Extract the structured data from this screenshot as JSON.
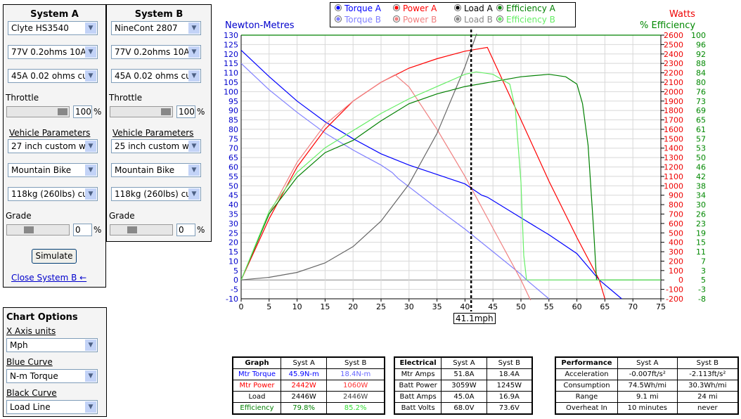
{
  "systemA": {
    "title": "System A",
    "motor": "Clyte HS3540",
    "battery": "77V 0.2ohms 10A",
    "controller": "45A 0.02 ohms cu",
    "throttle_label": "Throttle",
    "throttle": "100",
    "pct": "%",
    "vehicle_label": "Vehicle Parameters",
    "wheel": "27 inch custom w",
    "frame": "Mountain Bike",
    "weight": "118kg (260lbs) cu",
    "grade_label": "Grade",
    "grade": "0",
    "simulate": "Simulate",
    "close_b": "Close System B ←"
  },
  "systemB": {
    "title": "System B",
    "motor": "NineCont 2807",
    "battery": "77V 0.2ohms 10A",
    "controller": "45A 0.02 ohms cu",
    "throttle_label": "Throttle",
    "throttle": "100",
    "pct": "%",
    "vehicle_label": "Vehicle Parameters",
    "wheel": "25 inch custom w",
    "frame": "Mountain Bike",
    "weight": "118kg (260lbs) cu",
    "grade_label": "Grade",
    "grade": "0"
  },
  "chart_options": {
    "title": "Chart Options",
    "x_axis_label": "X Axis units",
    "x_axis": "Mph",
    "blue_label": "Blue Curve",
    "blue": "N-m Torque",
    "black_label": "Black Curve",
    "black": "Load Line"
  },
  "legend": [
    {
      "label": "Torque A",
      "color": "#0000ff"
    },
    {
      "label": "Power A",
      "color": "#ff0000"
    },
    {
      "label": "Load A",
      "color": "#000000"
    },
    {
      "label": "Efficiency A",
      "color": "#008000"
    },
    {
      "label": "Torque B",
      "color": "#8080ff"
    },
    {
      "label": "Power B",
      "color": "#f08080"
    },
    {
      "label": "Load B",
      "color": "#888888"
    },
    {
      "label": "Efficiency B",
      "color": "#66ee66"
    }
  ],
  "chart_data": {
    "type": "line",
    "ylabel_left": "Newton-Metres",
    "ylabel_right1": "Watts",
    "ylabel_right2": "% Efficiency",
    "x_ticks": [
      0,
      5,
      10,
      15,
      20,
      25,
      30,
      35,
      40,
      45,
      50,
      55,
      60,
      65,
      70,
      75
    ],
    "xlim": [
      0,
      75
    ],
    "ylim_left": [
      -10,
      130
    ],
    "ylim_watts": [
      -200,
      2600
    ],
    "left_ticks": [
      130,
      125,
      120,
      115,
      110,
      105,
      100,
      95,
      90,
      85,
      80,
      75,
      70,
      65,
      60,
      55,
      50,
      45,
      40,
      35,
      30,
      25,
      20,
      15,
      10,
      5,
      0,
      -5,
      -10
    ],
    "watts_ticks": [
      2600,
      2500,
      2400,
      2300,
      2200,
      2100,
      2000,
      1900,
      1800,
      1700,
      1600,
      1500,
      1400,
      1300,
      1200,
      1100,
      1000,
      900,
      800,
      700,
      600,
      500,
      400,
      300,
      200,
      100,
      0,
      -100,
      -200
    ],
    "eff_ticks": [
      "100",
      "96",
      "92",
      "88",
      "84",
      "80",
      "76",
      "73",
      "69",
      "65",
      "61",
      "57",
      "53",
      "50",
      "46",
      "42",
      "38",
      "34",
      "30",
      "26",
      "23",
      "19",
      "15",
      "11",
      "7",
      "3",
      "5",
      "-3",
      "-8"
    ],
    "grid": true,
    "cursor_x": 41.1,
    "cursor_label": "41.1mph",
    "series": [
      {
        "name": "Torque A",
        "axis": "nm",
        "color": "#0000ff",
        "x": [
          0,
          5,
          10,
          15,
          20,
          25,
          30,
          35,
          40,
          43,
          44,
          50,
          55,
          60,
          64,
          68
        ],
        "y": [
          122,
          108,
          95,
          84,
          75,
          67,
          61,
          56,
          51,
          45,
          44,
          33,
          24,
          14,
          0,
          -10
        ]
      },
      {
        "name": "Torque B",
        "axis": "nm",
        "color": "#8080ff",
        "x": [
          0,
          5,
          10,
          15,
          20,
          25,
          27,
          28,
          35,
          40,
          45,
          50,
          51,
          55
        ],
        "y": [
          115,
          101,
          89,
          78,
          69,
          61,
          57,
          54,
          38,
          27,
          15,
          3,
          0,
          -10
        ]
      },
      {
        "name": "Power A",
        "axis": "watts",
        "color": "#ff0000",
        "x": [
          0,
          5,
          10,
          15,
          20,
          25,
          30,
          35,
          40,
          44,
          50,
          55,
          60,
          64,
          65
        ],
        "y": [
          0,
          650,
          1200,
          1600,
          1900,
          2100,
          2250,
          2350,
          2430,
          2470,
          1700,
          1050,
          450,
          0,
          -200
        ]
      },
      {
        "name": "Power B",
        "axis": "watts",
        "color": "#f08080",
        "x": [
          0,
          5,
          10,
          15,
          20,
          25,
          27.5,
          30,
          35,
          40,
          45,
          50,
          52
        ],
        "y": [
          0,
          700,
          1250,
          1650,
          1900,
          2100,
          2180,
          2050,
          1600,
          1100,
          550,
          0,
          -250
        ]
      },
      {
        "name": "Load A",
        "axis": "watts",
        "color": "#666666",
        "x": [
          0,
          5,
          10,
          15,
          20,
          25,
          30,
          35,
          40,
          42,
          43
        ],
        "y": [
          0,
          28,
          80,
          181,
          354,
          625,
          1018,
          1556,
          2264,
          2600,
          2800
        ]
      },
      {
        "name": "Efficiency A",
        "axis": "eff",
        "color": "#008000",
        "x": [
          0,
          5,
          10,
          15,
          20,
          25,
          30,
          35,
          40,
          45,
          50,
          55,
          58,
          60,
          61,
          62,
          63,
          63.5,
          75
        ],
        "y": [
          0,
          27,
          42,
          52,
          57,
          65,
          72,
          76,
          79,
          81,
          83,
          84,
          83,
          80,
          72,
          55,
          20,
          0,
          0
        ]
      },
      {
        "name": "Efficiency B",
        "axis": "eff",
        "color": "#66ee66",
        "x": [
          0,
          5,
          10,
          15,
          20,
          25,
          30,
          35,
          40,
          42,
          45,
          48,
          49,
          50,
          50.5,
          51,
          75
        ],
        "y": [
          0,
          28,
          44,
          54,
          61,
          68,
          74,
          79,
          84,
          85,
          84,
          80,
          70,
          40,
          10,
          0,
          0
        ]
      }
    ]
  },
  "tables": {
    "graph": {
      "headers": [
        "Graph",
        "Syst A",
        "Syst B"
      ],
      "rows": [
        [
          "Mtr Torque",
          "45.9N-m",
          "18.4N-m"
        ],
        [
          "Mtr Power",
          "2442W",
          "1060W"
        ],
        [
          "Load",
          "2446W",
          "2446W"
        ],
        [
          "Efficiency",
          "79.8%",
          "85.2%"
        ]
      ],
      "row_colors": [
        "#0000ff",
        "#ff0000",
        "#000000",
        "#008000"
      ],
      "b_colors": [
        "#6666ff",
        "#ff3333",
        "#444444",
        "#33dd33"
      ]
    },
    "electrical": {
      "headers": [
        "Electrical",
        "Syst A",
        "Syst B"
      ],
      "rows": [
        [
          "Mtr Amps",
          "51.8A",
          "18.4A"
        ],
        [
          "Batt Power",
          "3059W",
          "1245W"
        ],
        [
          "Batt Amps",
          "45.0A",
          "16.9A"
        ],
        [
          "Batt Volts",
          "68.0V",
          "73.6V"
        ]
      ]
    },
    "performance": {
      "headers": [
        "Performance",
        "Syst A",
        "Syst B"
      ],
      "rows": [
        [
          "Acceleration",
          "-0.007ft/s²",
          "-2.113ft/s²"
        ],
        [
          "Consumption",
          "74.5Wh/mi",
          "30.3Wh/mi"
        ],
        [
          "Range",
          "9.1 mi",
          "24 mi"
        ],
        [
          "Overheat In",
          "10 minutes",
          "never"
        ]
      ]
    }
  }
}
